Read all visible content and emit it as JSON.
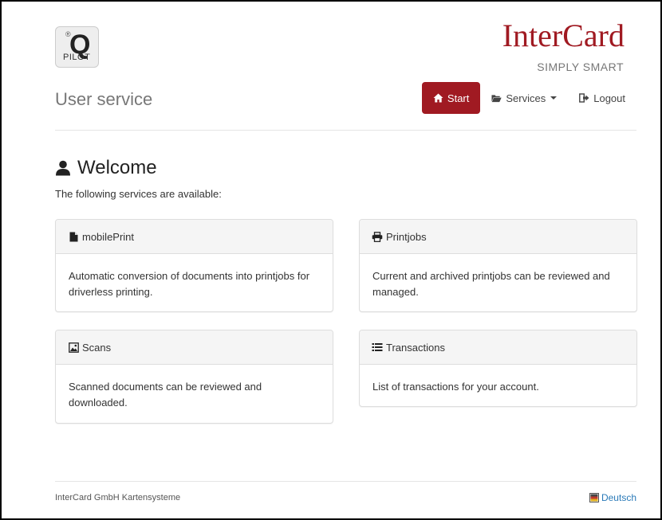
{
  "header": {
    "logo_registered": "®",
    "logo_letter": "Q",
    "logo_text": "PILOT",
    "brand_name": "InterCard",
    "brand_tagline": "SIMPLY SMART",
    "app_title": "User service"
  },
  "nav": {
    "start_label": "Start",
    "services_label": "Services",
    "logout_label": "Logout"
  },
  "main": {
    "welcome_title": "Welcome",
    "intro_text": "The following services are available:",
    "panels": [
      {
        "title": "mobilePrint",
        "icon": "file-icon",
        "description": "Automatic conversion of documents into printjobs for driverless printing."
      },
      {
        "title": "Printjobs",
        "icon": "printer-icon",
        "description": "Current and archived printjobs can be reviewed and managed."
      },
      {
        "title": "Scans",
        "icon": "image-icon",
        "description": "Scanned documents can be reviewed and downloaded."
      },
      {
        "title": "Transactions",
        "icon": "list-icon",
        "description": "List of transactions for your account."
      }
    ]
  },
  "footer": {
    "company": "InterCard GmbH Kartensysteme",
    "language_link": "Deutsch"
  },
  "colors": {
    "brand": "#a01a22",
    "link": "#2a7ab8",
    "panel_header": "#f5f5f5"
  }
}
